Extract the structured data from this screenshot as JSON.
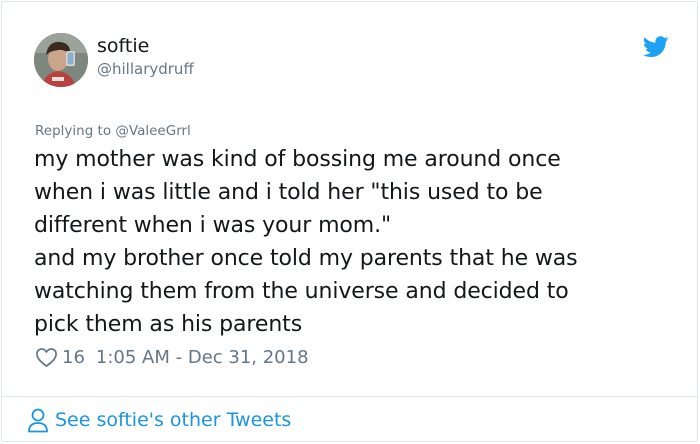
{
  "user": {
    "display_name": "softie",
    "handle": "@hillarydruff"
  },
  "reply": {
    "prefix": "Replying to",
    "mention": "@ValeeGrrl"
  },
  "tweet": {
    "text": "my mother was kind of bossing me around once\nwhen i was little and i told her \"this used to be\ndifferent when i was your mom.\"\nand my brother once told my parents that he was\nwatching them from the universe and decided to\npick them as his parents",
    "like_count": "16",
    "timestamp": "1:05 AM - Dec 31, 2018"
  },
  "footer": {
    "see_more_label": "See softie's other Tweets"
  },
  "colors": {
    "twitter_blue": "#1da1f2",
    "link_blue": "#1b95e0",
    "secondary_text": "#657786",
    "border": "#e1e8ed"
  },
  "icons": {
    "brand": "twitter-bird-icon",
    "like": "heart-outline-icon",
    "profile": "person-outline-icon"
  }
}
